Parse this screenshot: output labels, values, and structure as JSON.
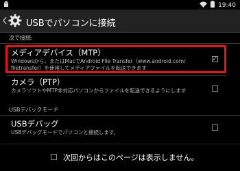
{
  "status_bar": {
    "left_icon": "android-icon",
    "icons": [
      "wifi-icon",
      "battery-icon"
    ],
    "time": "19:40"
  },
  "action_bar": {
    "back_icon": "chevron-left-icon",
    "app_icon": "usb-settings-gear-icon",
    "title": "USBでパソコンに接続"
  },
  "sections": [
    {
      "header": "次で接続:",
      "items": [
        {
          "title": "メディアデバイス（MTP）",
          "summary_line1": "Windowsから、またはMacでAndroid File Transfer（www.android.com/",
          "summary_line2": "filetransfer）を使用してメディアファイルを転送できます",
          "checked": true,
          "highlighted": true
        },
        {
          "title": "カメラ（PTP）",
          "summary_line1": "カメラソフトやMTP非対応パソコンからファイルを転送できるようにします",
          "checked": false
        }
      ]
    },
    {
      "header": "USBデバックモード",
      "items": [
        {
          "title": "USBデバッグ",
          "summary_line1": "USBデバッグモードでパソコンと接続します。",
          "checked": false
        }
      ]
    }
  ],
  "footer": {
    "label": "次回からはこのページは表示しません。",
    "checked": false
  },
  "colors": {
    "background": "#000000",
    "action_bar": "#222222",
    "highlight_border": "#e8141a",
    "check_accent": "#33b5e5"
  }
}
